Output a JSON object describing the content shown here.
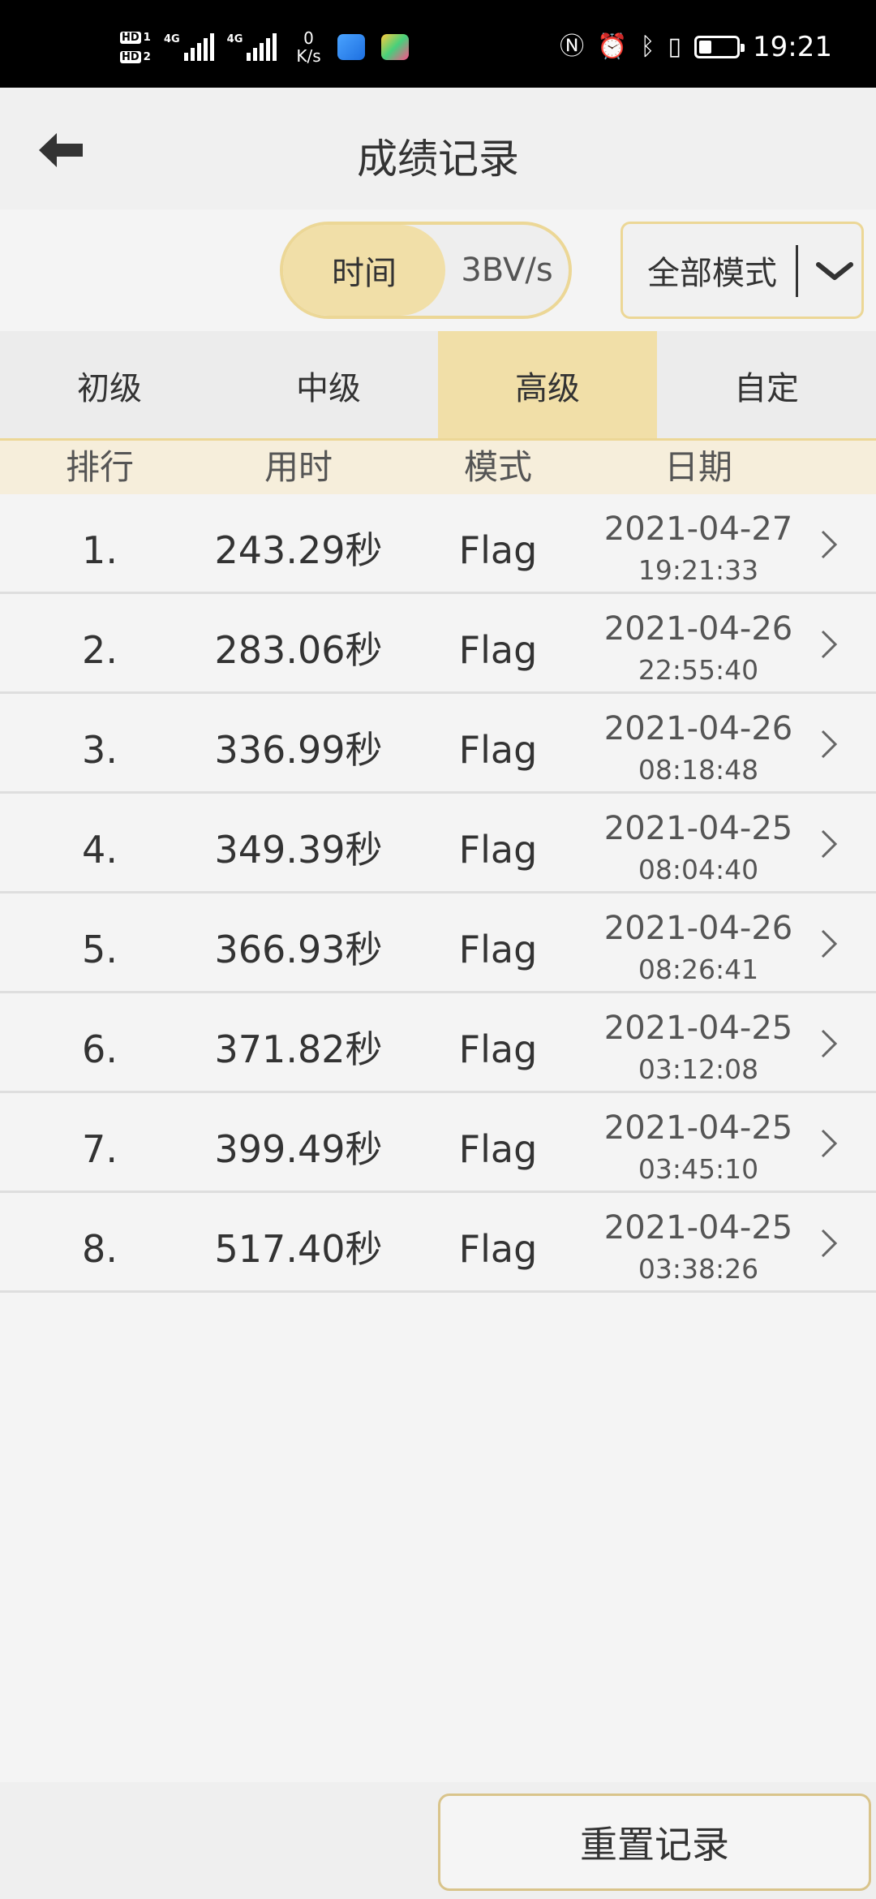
{
  "status_bar": {
    "hd1": "HD",
    "hd1_sub": "1",
    "hd2": "HD",
    "hd2_sub": "2",
    "sim1": "4G",
    "sim2": "4G",
    "net_speed_value": "0",
    "net_speed_unit": "K/s",
    "time": "19:21",
    "battery_level": 0.35
  },
  "header": {
    "title": "成绩记录",
    "back_icon": "arrow-left-icon"
  },
  "controls": {
    "sort_selected": "时间",
    "sort_other": "3BV/s",
    "mode_select_value": "全部模式",
    "mode_select_icon": "chevron-down-icon"
  },
  "tabs": [
    {
      "label": "初级",
      "active": false
    },
    {
      "label": "中级",
      "active": false
    },
    {
      "label": "高级",
      "active": true
    },
    {
      "label": "自定",
      "active": false
    }
  ],
  "columns": {
    "rank": "排行",
    "time": "用时",
    "mode": "模式",
    "date": "日期"
  },
  "records": [
    {
      "rank": "1.",
      "time": "243.29秒",
      "mode": "Flag",
      "date": "2021-04-27",
      "clock": "19:21:33"
    },
    {
      "rank": "2.",
      "time": "283.06秒",
      "mode": "Flag",
      "date": "2021-04-26",
      "clock": "22:55:40"
    },
    {
      "rank": "3.",
      "time": "336.99秒",
      "mode": "Flag",
      "date": "2021-04-26",
      "clock": "08:18:48"
    },
    {
      "rank": "4.",
      "time": "349.39秒",
      "mode": "Flag",
      "date": "2021-04-25",
      "clock": "08:04:40"
    },
    {
      "rank": "5.",
      "time": "366.93秒",
      "mode": "Flag",
      "date": "2021-04-26",
      "clock": "08:26:41"
    },
    {
      "rank": "6.",
      "time": "371.82秒",
      "mode": "Flag",
      "date": "2021-04-25",
      "clock": "03:12:08"
    },
    {
      "rank": "7.",
      "time": "399.49秒",
      "mode": "Flag",
      "date": "2021-04-25",
      "clock": "03:45:10"
    },
    {
      "rank": "8.",
      "time": "517.40秒",
      "mode": "Flag",
      "date": "2021-04-25",
      "clock": "03:38:26"
    }
  ],
  "footer": {
    "reset_label": "重置记录"
  },
  "colors": {
    "accent": "#f1dfa8",
    "accent_border": "#ecd796",
    "header_bg": "#f6eedb"
  }
}
